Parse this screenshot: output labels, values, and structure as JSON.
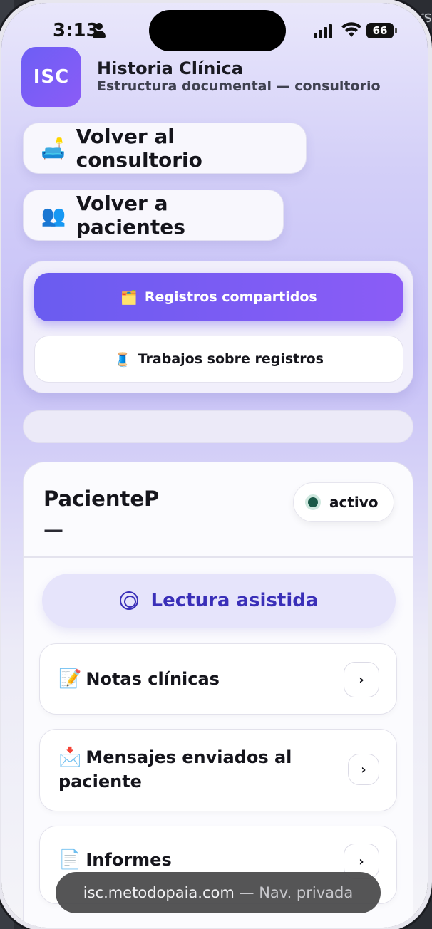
{
  "status_bar": {
    "time": "3:13",
    "battery": "66"
  },
  "header": {
    "logo_text": "ISC",
    "title": "Historia Clínica",
    "subtitle": "Estructura documental — consultorio"
  },
  "nav": {
    "back_office": {
      "icon": "🛋️",
      "label": "Volver al consultorio"
    },
    "back_patients": {
      "icon": "👥",
      "label": "Volver a pacientes"
    }
  },
  "segments": {
    "shared": {
      "icon": "🗂️",
      "label": "Registros compartidos"
    },
    "works": {
      "icon": "🧵",
      "label": "Trabajos sobre registros"
    }
  },
  "patient": {
    "name": "PacienteP",
    "dash": "—",
    "status": "activo"
  },
  "assist": {
    "label": "Lectura asistida"
  },
  "sections": [
    {
      "icon": "📝",
      "label": "Notas clínicas",
      "chevron": "›"
    },
    {
      "icon": "📩",
      "label": "Mensajes enviados al paciente",
      "chevron": "›"
    },
    {
      "icon": "📄",
      "label": "Informes",
      "chevron": "›"
    }
  ],
  "browser": {
    "url": "isc.metodopaia.com",
    "mode": "— Nav. privada"
  },
  "background_text": "rs",
  "colors": {
    "accent": "#6a5cf0",
    "accent2": "#8b5cf6",
    "assist_text": "#3a2fb8",
    "status_dot": "#1a5a48"
  }
}
